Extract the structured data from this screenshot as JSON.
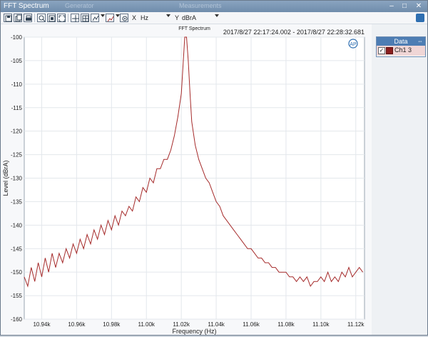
{
  "window": {
    "title": "FFT Spectrum",
    "ghost_tabs": [
      "Generator",
      "Measurements"
    ]
  },
  "toolbar": {
    "x_label": "X",
    "x_unit": "Hz",
    "y_label": "Y",
    "y_unit": "dBrA"
  },
  "legend": {
    "header": "Data",
    "pin_icon": "pin-icon",
    "items": [
      {
        "checked": true,
        "color": "#8a1e1e",
        "label": "Ch1 3"
      }
    ]
  },
  "chart_data": {
    "type": "line",
    "title": "FFT Spectrum",
    "timestamp": "2017/8/27 22:17:24.002 - 2017/8/27 22:28:32.681",
    "xlabel": "Frequency (Hz)",
    "ylabel": "Level (dBrA)",
    "xlim": [
      10930,
      11125
    ],
    "ylim": [
      -160,
      -100
    ],
    "x_ticks": [
      10940,
      10960,
      10980,
      11000,
      11020,
      11040,
      11060,
      11080,
      11100,
      11120
    ],
    "x_tick_labels": [
      "10.94k",
      "10.96k",
      "10.98k",
      "11.00k",
      "11.02k",
      "11.04k",
      "11.06k",
      "11.08k",
      "11.10k",
      "11.12k"
    ],
    "y_ticks": [
      -100,
      -105,
      -110,
      -115,
      -120,
      -125,
      -130,
      -135,
      -140,
      -145,
      -150,
      -155,
      -160
    ],
    "y_tick_labels": [
      "-100",
      "-105",
      "-110",
      "-115",
      "-120",
      "-125",
      "-130",
      "-135",
      "-140",
      "-145",
      "-150",
      "-155",
      "-160"
    ],
    "grid": true,
    "series": [
      {
        "name": "Ch1 3",
        "color": "#a52a2a",
        "x": [
          10930,
          10932,
          10934,
          10936,
          10938,
          10940,
          10942,
          10944,
          10946,
          10948,
          10950,
          10952,
          10954,
          10956,
          10958,
          10960,
          10962,
          10964,
          10966,
          10968,
          10970,
          10972,
          10974,
          10976,
          10978,
          10980,
          10982,
          10984,
          10986,
          10988,
          10990,
          10992,
          10994,
          10996,
          10998,
          11000,
          11002,
          11004,
          11006,
          11008,
          11010,
          11012,
          11014,
          11016,
          11018,
          11020,
          11021,
          11022,
          11023,
          11024,
          11025,
          11026,
          11028,
          11030,
          11032,
          11034,
          11036,
          11038,
          11040,
          11042,
          11044,
          11046,
          11048,
          11050,
          11052,
          11054,
          11056,
          11058,
          11060,
          11062,
          11064,
          11066,
          11068,
          11070,
          11072,
          11074,
          11076,
          11078,
          11080,
          11082,
          11084,
          11086,
          11088,
          11090,
          11092,
          11094,
          11096,
          11098,
          11100,
          11102,
          11104,
          11106,
          11108,
          11110,
          11112,
          11114,
          11116,
          11118,
          11120,
          11122,
          11124
        ],
        "y": [
          -151,
          -153,
          -149,
          -152,
          -148,
          -151,
          -147,
          -150,
          -146,
          -149,
          -146,
          -148,
          -145,
          -147,
          -144,
          -146,
          -143,
          -145,
          -142,
          -144,
          -141,
          -143,
          -140,
          -142,
          -139,
          -141,
          -138,
          -140,
          -137,
          -138,
          -136,
          -137,
          -134,
          -135,
          -132,
          -133,
          -130,
          -131,
          -128,
          -128,
          -126,
          -126,
          -124,
          -121,
          -117,
          -112,
          -106,
          -100,
          -100,
          -105,
          -112,
          -118,
          -123,
          -126,
          -128,
          -130,
          -131,
          -133,
          -135,
          -136,
          -138,
          -139,
          -140,
          -141,
          -142,
          -143,
          -144,
          -145,
          -145,
          -146,
          -147,
          -147,
          -148,
          -148,
          -149,
          -149,
          -150,
          -150,
          -150,
          -151,
          -151,
          -152,
          -151,
          -152,
          -151,
          -153,
          -152,
          -152,
          -151,
          -152,
          -150,
          -152,
          -151,
          -152,
          -150,
          -151,
          -149,
          -151,
          -150,
          -149,
          -150
        ]
      }
    ]
  }
}
